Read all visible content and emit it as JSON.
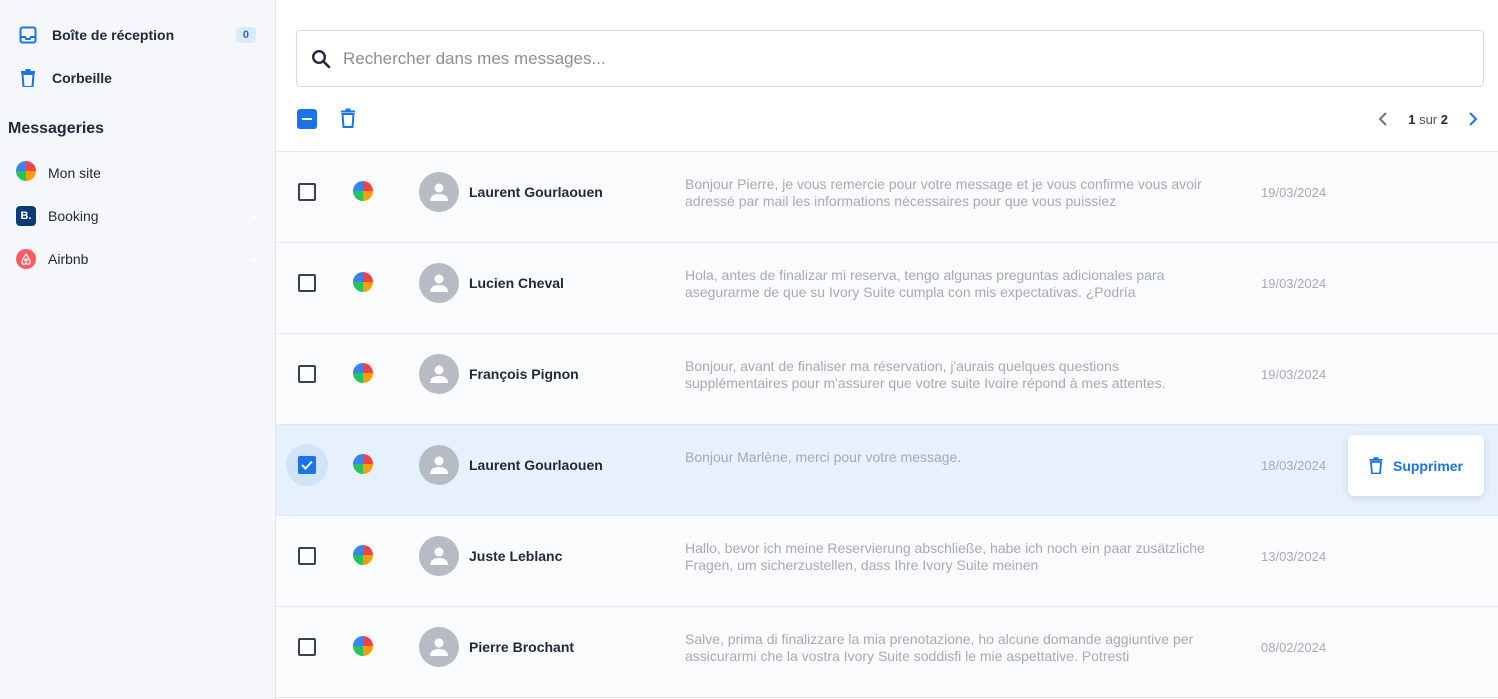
{
  "sidebar": {
    "inbox": {
      "label": "Boîte de réception",
      "badge": "0",
      "icon": "inbox-icon"
    },
    "trash": {
      "label": "Corbeille",
      "icon": "trash-icon"
    },
    "section_title": "Messageries",
    "channels": [
      {
        "label": "Mon site",
        "icon": "mon-site-logo-icon"
      },
      {
        "label": "Booking",
        "icon": "booking-logo-icon",
        "logo_text": "B."
      },
      {
        "label": "Airbnb",
        "icon": "airbnb-logo-icon"
      }
    ]
  },
  "search": {
    "placeholder": "Rechercher dans mes messages...",
    "value": ""
  },
  "toolbar": {
    "select_all_state": "indeterminate",
    "delete_icon": "trash-icon"
  },
  "pagination": {
    "current": "1",
    "separator": "sur",
    "total": "2"
  },
  "messages": [
    {
      "sender": "Laurent Gourlaouen",
      "preview": "Bonjour Pierre, je vous remercie pour votre message et je vous confirme vous avoir adressé par mail les informations nécessaires pour que vous puissiez",
      "date": "19/03/2024",
      "checked": false
    },
    {
      "sender": "Lucien Cheval",
      "preview": "Hola, antes de finalizar mi reserva, tengo algunas preguntas adicionales para asegurarme de que su Ivory Suite cumpla con mis expectativas. ¿Podría",
      "date": "19/03/2024",
      "checked": false
    },
    {
      "sender": "François Pignon",
      "preview": "Bonjour, avant de finaliser ma réservation, j'aurais quelques questions supplémentaires pour m'assurer que votre suite Ivoire répond à mes attentes.",
      "date": "19/03/2024",
      "checked": false
    },
    {
      "sender": "Laurent Gourlaouen",
      "preview": "Bonjour Marlène, merci pour votre message.",
      "date": "18/03/2024",
      "checked": true
    },
    {
      "sender": "Juste Leblanc",
      "preview": "Hallo, bevor ich meine Reservierung abschließe, habe ich noch ein paar zusätzliche Fragen, um sicherzustellen, dass Ihre Ivory Suite meinen",
      "date": "13/03/2024",
      "checked": false
    },
    {
      "sender": "Pierre Brochant",
      "preview": "Salve, prima di finalizzare la mia prenotazione, ho alcune domande aggiuntive per assicurarmi che la vostra Ivory Suite soddisfi le mie aspettative. Potresti",
      "date": "08/02/2024",
      "checked": false
    }
  ],
  "row_action": {
    "label": "Supprimer",
    "icon": "trash-icon"
  },
  "colors": {
    "accent": "#1a73e8",
    "selected_row": "#e6f1fd",
    "sidebar_bg": "#f5f7fb"
  }
}
